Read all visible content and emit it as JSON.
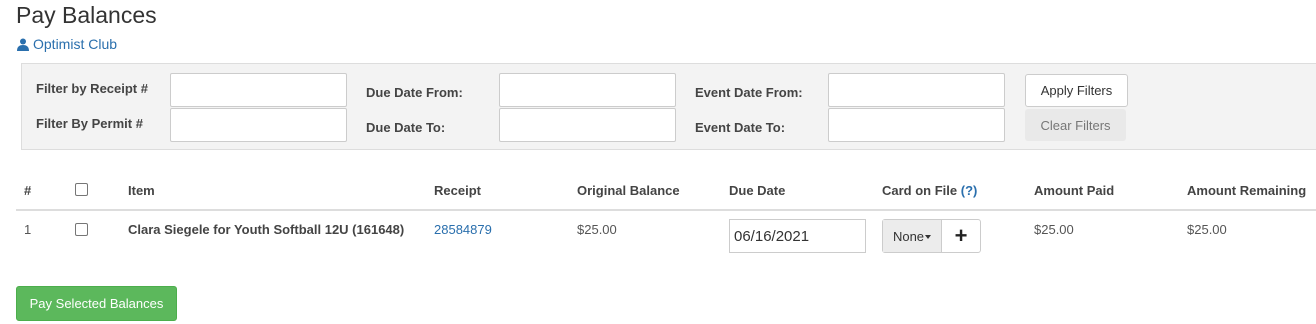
{
  "page": {
    "title": "Pay Balances",
    "org_name": "Optimist Club"
  },
  "filters": {
    "receipt_label": "Filter by Receipt #",
    "permit_label": "Filter By Permit #",
    "due_from_label": "Due Date From:",
    "due_to_label": "Due Date To:",
    "event_from_label": "Event Date From:",
    "event_to_label": "Event Date To:",
    "receipt_value": "",
    "permit_value": "",
    "due_from_value": "",
    "due_to_value": "",
    "event_from_value": "",
    "event_to_value": "",
    "apply_label": "Apply Filters",
    "clear_label": "Clear Filters"
  },
  "table": {
    "headers": {
      "num": "#",
      "item": "Item",
      "receipt": "Receipt",
      "original_balance": "Original Balance",
      "due_date": "Due Date",
      "card_on_file": "Card on File",
      "card_help": "(?)",
      "amount_paid": "Amount Paid",
      "amount_remaining": "Amount Remaining"
    },
    "rows": [
      {
        "num": "1",
        "item": "Clara Siegele for Youth Softball 12U (161648)",
        "receipt": "28584879",
        "original_balance": "$25.00",
        "due_date": "06/16/2021",
        "card_selected": "None",
        "add_card": "+",
        "amount_paid": "$25.00",
        "amount_remaining": "$25.00"
      }
    ]
  },
  "actions": {
    "pay_label": "Pay Selected Balances"
  },
  "colors": {
    "link": "#2a6fad",
    "success": "#5cb85c",
    "panel": "#f3f3f3"
  },
  "icons": {
    "org": "user-icon",
    "select_caret": "caret-down-icon"
  }
}
